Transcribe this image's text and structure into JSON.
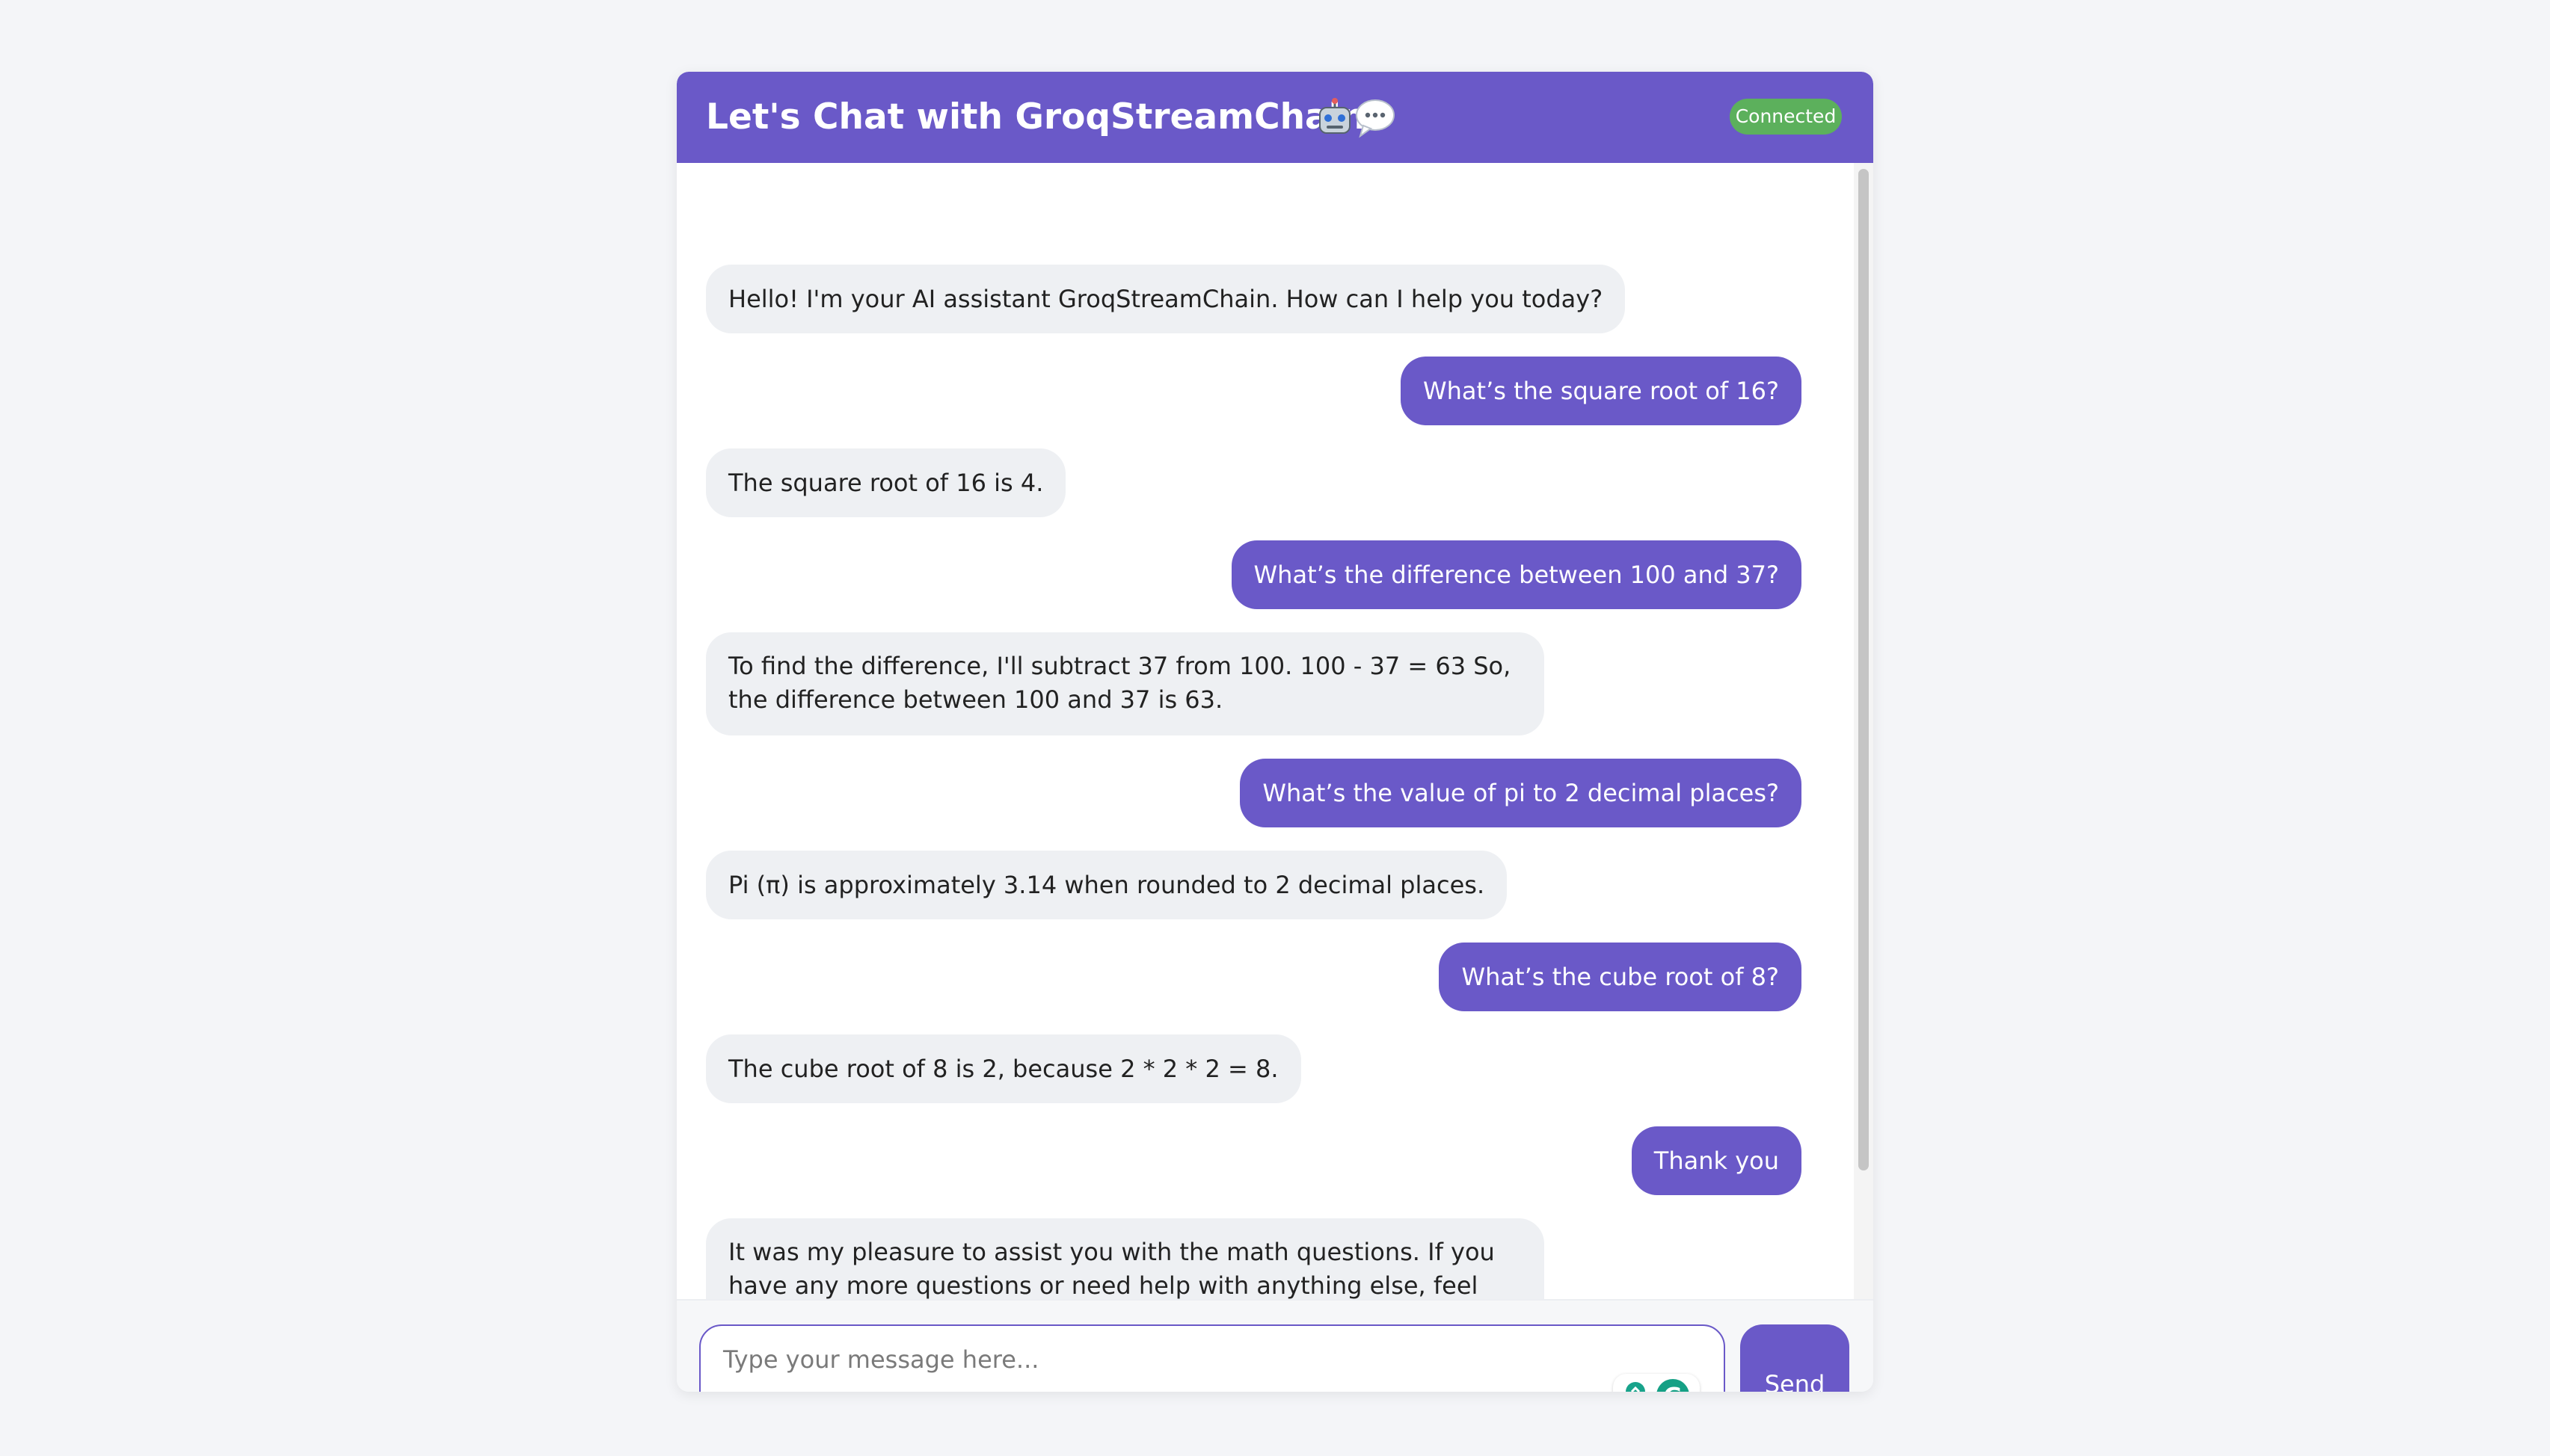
{
  "header": {
    "title": "Let's Chat with GroqStreamChain",
    "title_icons": [
      "robot-icon",
      "speech-bubble-icon"
    ],
    "status": "Connected"
  },
  "messages": [
    {
      "role": "bot",
      "text": "Hello! I'm your AI assistant GroqStreamChain. How can I help you today?"
    },
    {
      "role": "user",
      "text": "What’s the square root of 16?"
    },
    {
      "role": "bot",
      "text": "The square root of 16 is 4."
    },
    {
      "role": "user",
      "text": "What’s the difference between 100 and 37?"
    },
    {
      "role": "bot",
      "text": "To find the difference, I'll subtract 37 from 100. 100 - 37 = 63 So, the difference between 100 and 37 is 63."
    },
    {
      "role": "user",
      "text": "What’s the value of pi to 2 decimal places?"
    },
    {
      "role": "bot",
      "text": "Pi (π) is approximately 3.14 when rounded to 2 decimal places."
    },
    {
      "role": "user",
      "text": "What’s the cube root of 8?"
    },
    {
      "role": "bot",
      "text": "The cube root of 8 is 2, because 2 * 2 * 2 = 8."
    },
    {
      "role": "user",
      "text": "Thank you"
    },
    {
      "role": "bot",
      "text": "It was my pleasure to assist you with the math questions. If you have any more questions or need help with anything else, feel free to ask!"
    }
  ],
  "input": {
    "placeholder": "Type your message here...",
    "value": ""
  },
  "send_label": "Send",
  "colors": {
    "accent": "#6a59c8",
    "status_green": "#5cb05c",
    "bot_bubble": "#eef0f3",
    "page_bg": "#f4f5f8"
  }
}
